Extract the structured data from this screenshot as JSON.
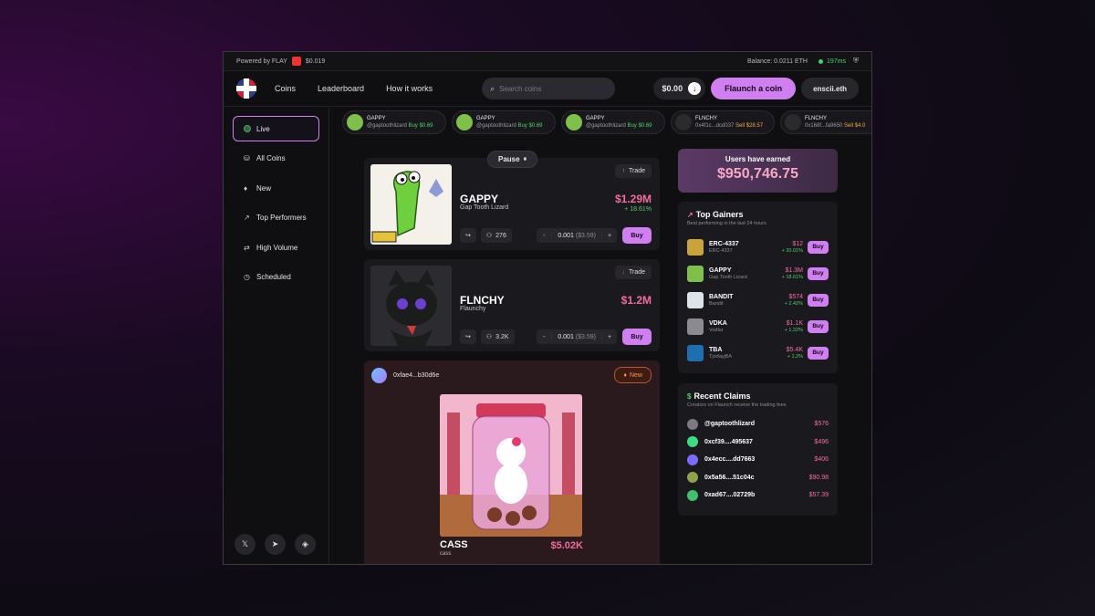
{
  "topbar": {
    "powered_by": "Powered by FLAY",
    "flay_price": "$0.019",
    "balance": "Balance: 0.0211 ETH",
    "ping": "197ms"
  },
  "nav": {
    "links": [
      "Coins",
      "Leaderboard",
      "How it works"
    ],
    "search_placeholder": "Search coins",
    "balance": "$0.00",
    "flaunch_label": "Flaunch a coin",
    "user": "enscii.eth"
  },
  "sidebar": {
    "items": [
      {
        "label": "Live",
        "icon": "live-dot-icon",
        "glyph": ""
      },
      {
        "label": "All Coins",
        "icon": "coins-icon",
        "glyph": "⛁"
      },
      {
        "label": "New",
        "icon": "flame-icon",
        "glyph": "♦"
      },
      {
        "label": "Top Performers",
        "icon": "trend-up-icon",
        "glyph": "↗"
      },
      {
        "label": "High Volume",
        "icon": "swap-icon",
        "glyph": "⇄"
      },
      {
        "label": "Scheduled",
        "icon": "clock-icon",
        "glyph": "◷"
      }
    ],
    "socials": [
      {
        "icon": "x-icon",
        "glyph": "𝕏"
      },
      {
        "icon": "telegram-icon",
        "glyph": "➤"
      },
      {
        "icon": "layers-icon",
        "glyph": "◈"
      }
    ]
  },
  "ticker": [
    {
      "name": "GAPPY",
      "user": "@gaptoothlizard",
      "action": "Buy $0.69",
      "type": "buy",
      "color": "#7fc04a"
    },
    {
      "name": "GAPPY",
      "user": "@gaptoothlizard",
      "action": "Buy $0.69",
      "type": "buy",
      "color": "#7fc04a"
    },
    {
      "name": "GAPPY",
      "user": "@gaptoothlizard",
      "action": "Buy $0.69",
      "type": "buy",
      "color": "#7fc04a"
    },
    {
      "name": "FLNCHY",
      "user": "0x4f1c...dcd037",
      "action": "Sell $28.57",
      "type": "sell",
      "color": "#2b2b2e"
    },
    {
      "name": "FLNCHY",
      "user": "0x168f...fa9650",
      "action": "Sell $4.0",
      "type": "sell",
      "color": "#2b2b2e"
    }
  ],
  "feed": {
    "pause_label": "Pause",
    "pause_glyph": "⏸",
    "cards": [
      {
        "name": "GAPPY",
        "subtitle": "Gap Tooth Lizard",
        "price": "$1.29M",
        "change": "+ 18.61%",
        "trade_label": "Trade",
        "trend": "up",
        "holders": "276",
        "amount": "0.001",
        "amount_usd": "($3.59)",
        "buy_label": "Buy"
      },
      {
        "name": "FLNCHY",
        "subtitle": "Flaunchy",
        "price": "$1.2M",
        "change": "",
        "trade_label": "Trade",
        "trend": "down",
        "holders": "3.2K",
        "amount": "0.001",
        "amount_usd": "($3.59)",
        "buy_label": "Buy"
      }
    ],
    "new_card": {
      "address": "0xfae4...b30d6e",
      "badge": "New",
      "name": "CASS",
      "subtitle": "cass",
      "market_cap": "$5.02K"
    }
  },
  "earned": {
    "label": "Users have earned",
    "amount": "$950,746.75"
  },
  "top_gainers": {
    "title": "Top Gainers",
    "desc": "Best performing in the last 24 hours",
    "buy_label": "Buy",
    "rows": [
      {
        "name": "ERC-4337",
        "sub": "ERC-4337",
        "price": "$12",
        "change": "+ 20.01%",
        "color": "#c8a43a"
      },
      {
        "name": "GAPPY",
        "sub": "Gap Tooth Lizard",
        "price": "$1.3M",
        "change": "+ 18.61%",
        "color": "#7fc04a"
      },
      {
        "name": "BANDIT",
        "sub": "Bandit",
        "price": "$574",
        "change": "+ 2.42%",
        "color": "#dde3ea"
      },
      {
        "name": "VDKA",
        "sub": "Vodka",
        "price": "$1.1K",
        "change": "+ 1.22%",
        "color": "#8a8a90"
      },
      {
        "name": "TBA",
        "sub": "TjodayjBA",
        "price": "$5.4K",
        "change": "+ 1.2%",
        "color": "#1e6fb0"
      }
    ]
  },
  "recent_claims": {
    "title": "Recent Claims",
    "desc": "Creators on Flaunch receive the trading fees",
    "rows": [
      {
        "name": "@gaptoothlizard",
        "amount": "$576",
        "color": "#7a7a80"
      },
      {
        "name": "0xcf39....495637",
        "amount": "$496",
        "color": "#3ddc84"
      },
      {
        "name": "0x4ecc....dd7663",
        "amount": "$406",
        "color": "#7a6cff"
      },
      {
        "name": "0x5a56....51c04c",
        "amount": "$90.98",
        "color": "#8fa34a"
      },
      {
        "name": "0xad67....02729b",
        "amount": "$57.39",
        "color": "#3fc26b"
      }
    ]
  },
  "colors": {
    "accent": "#d07ff0",
    "positive": "#4fd36a",
    "price": "#f36b9f",
    "sell": "#f2a93b"
  }
}
